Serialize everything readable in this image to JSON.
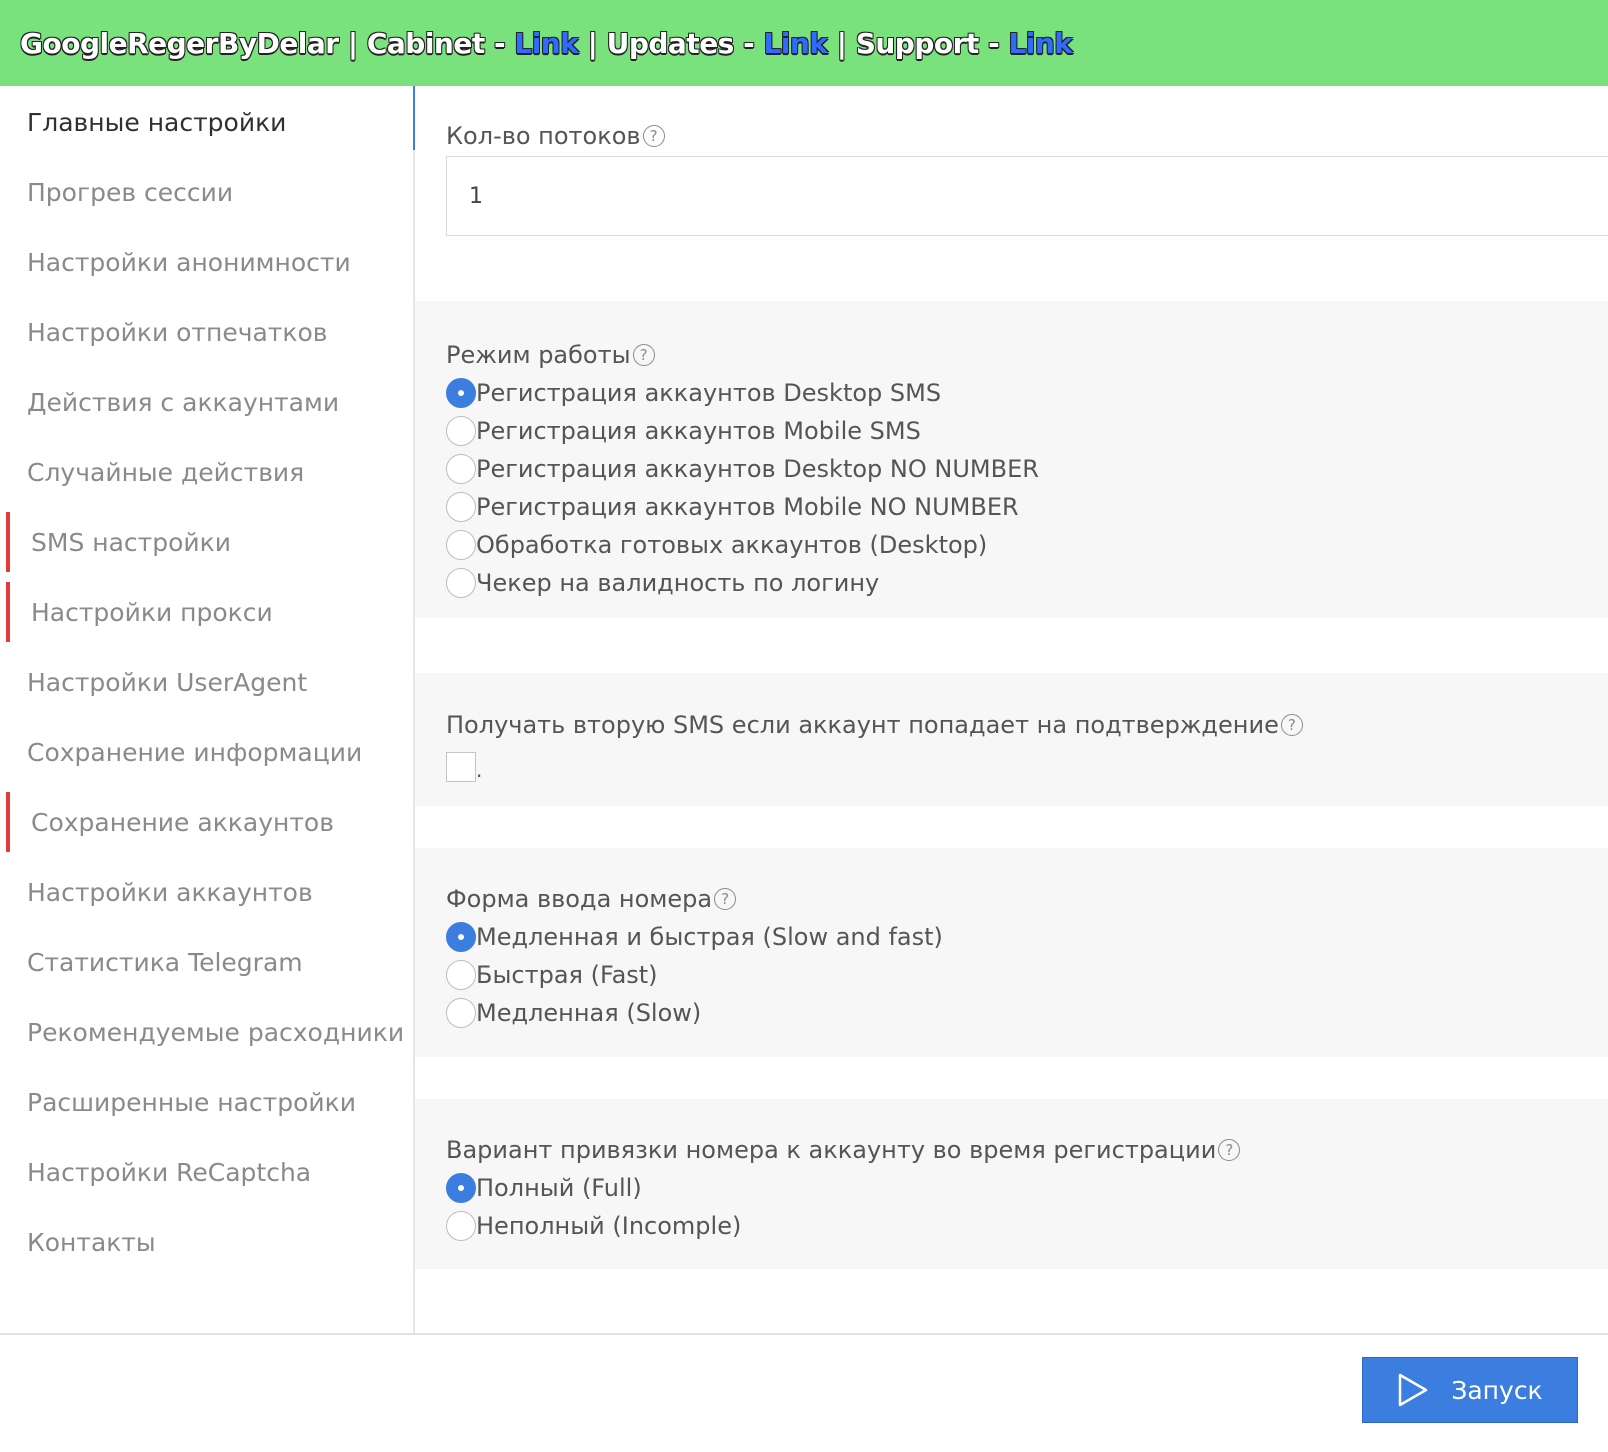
{
  "header": {
    "app_name": "GoogleRegerByDelar",
    "sep": " | ",
    "cabinet_label": "Cabinet - ",
    "updates_label": "Updates - ",
    "support_label": "Support - ",
    "link_text": "Link"
  },
  "sidebar": {
    "items": [
      {
        "label": "Главные настройки"
      },
      {
        "label": "Прогрев сессии"
      },
      {
        "label": "Настройки анонимности"
      },
      {
        "label": "Настройки отпечатков"
      },
      {
        "label": "Действия с аккаунтами"
      },
      {
        "label": "Случайные действия"
      },
      {
        "label": "SMS настройки"
      },
      {
        "label": "Настройки прокси"
      },
      {
        "label": "Настройки UserAgent"
      },
      {
        "label": "Сохранение информации"
      },
      {
        "label": "Сохранение аккаунтов"
      },
      {
        "label": "Настройки аккаунтов"
      },
      {
        "label": "Статистика Telegram"
      },
      {
        "label": "Рекомендуемые расходники"
      },
      {
        "label": "Расширенные настройки"
      },
      {
        "label": "Настройки ReCaptcha"
      },
      {
        "label": "Контакты"
      }
    ]
  },
  "threads": {
    "label": "Кол-во потоков",
    "value": "1"
  },
  "help_glyph": "?",
  "mode": {
    "label": "Режим работы",
    "options": [
      {
        "label": "Регистрация аккаунтов Desktop SMS",
        "selected": true
      },
      {
        "label": "Регистрация аккаунтов Mobile SMS",
        "selected": false
      },
      {
        "label": "Регистрация аккаунтов Desktop NO NUMBER",
        "selected": false
      },
      {
        "label": "Регистрация аккаунтов Mobile NO NUMBER",
        "selected": false
      },
      {
        "label": "Обработка готовых аккаунтов (Desktop)",
        "selected": false
      },
      {
        "label": "Чекер на валидность по логину",
        "selected": false
      }
    ]
  },
  "second_sms": {
    "label": "Получать вторую SMS если аккаунт попадает на подтверждение",
    "checked": false,
    "suffix": "."
  },
  "number_input": {
    "label": "Форма ввода номера",
    "options": [
      {
        "label": "Медленная и быстрая (Slow and fast)",
        "selected": true
      },
      {
        "label": "Быстрая (Fast)",
        "selected": false
      },
      {
        "label": "Медленная (Slow)",
        "selected": false
      }
    ]
  },
  "binding": {
    "label": "Вариант привязки номера к аккаунту во время регистрации",
    "options": [
      {
        "label": "Полный (Full)",
        "selected": true
      },
      {
        "label": "Неполный (Incomple)",
        "selected": false
      }
    ]
  },
  "footer": {
    "start_label": "Запуск"
  },
  "colors": {
    "header_bg": "#7ae27d",
    "link": "#2f6bff",
    "accent": "#3c7de0",
    "marker": "#e23b3b",
    "panel_bg": "#f7f7f7"
  }
}
